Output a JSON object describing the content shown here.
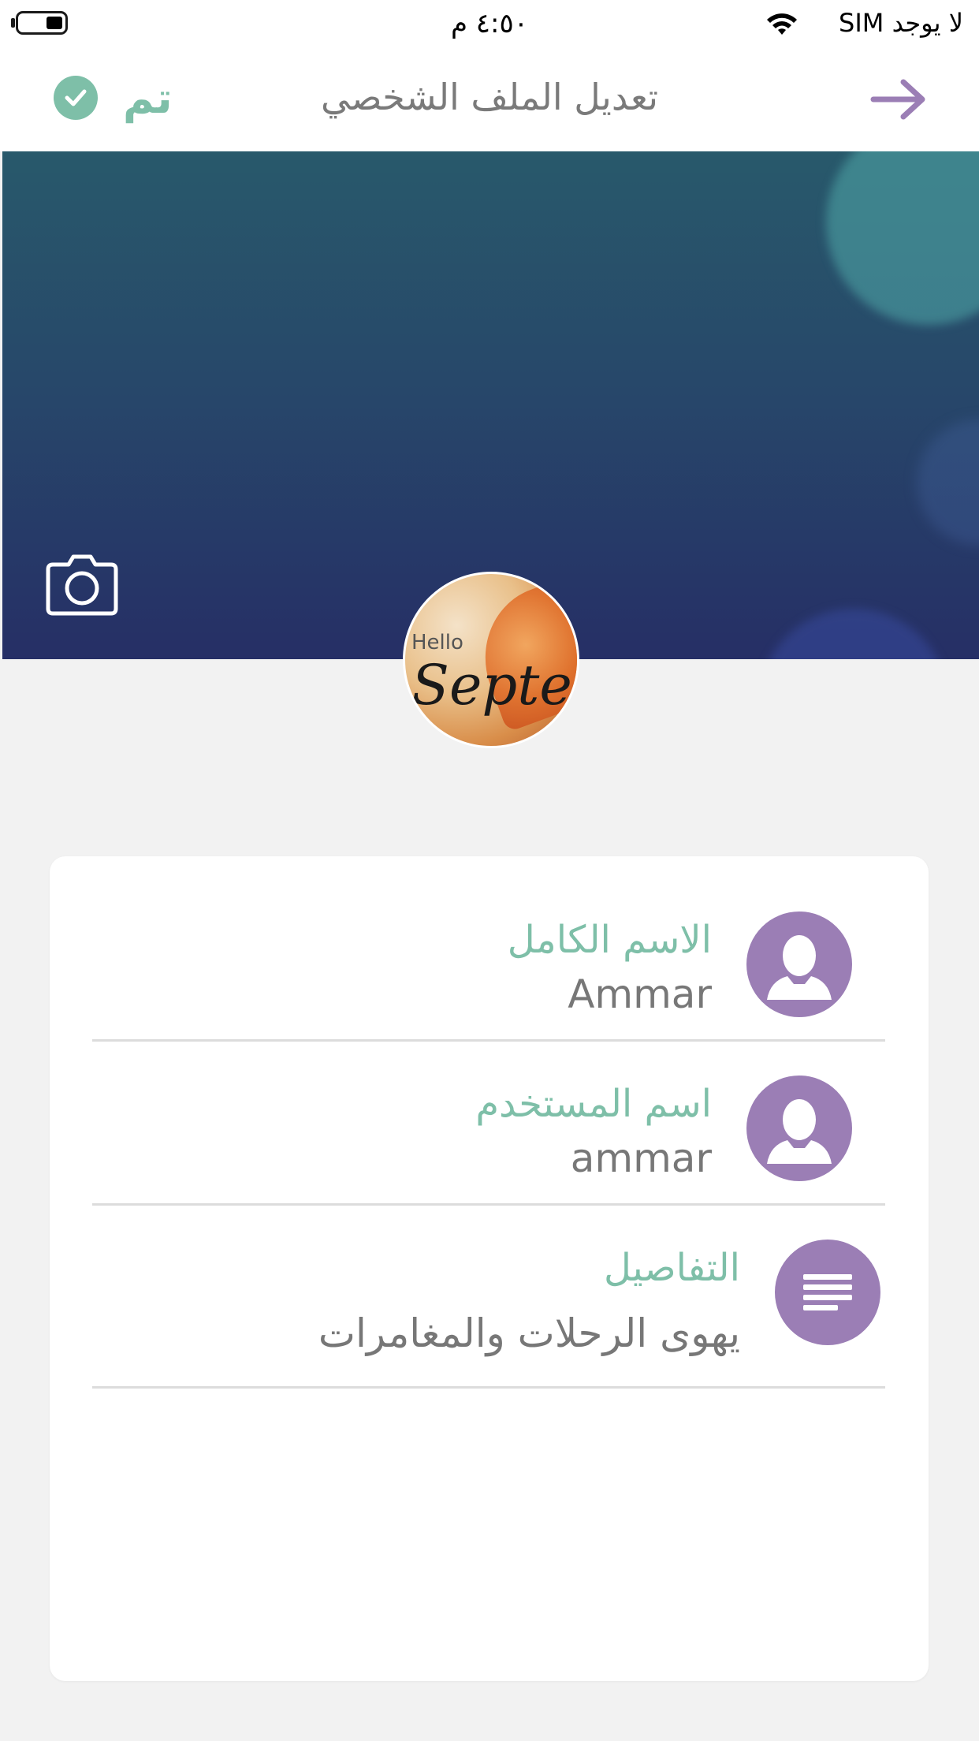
{
  "status_bar": {
    "carrier": "لا يوجد SIM",
    "time": "٤:٥٠ م",
    "wifi_icon": "wifi-icon",
    "battery_icon": "battery-icon"
  },
  "nav": {
    "title": "تعديل الملف الشخصي",
    "done_label": "تم",
    "done_icon": "check-circle-icon",
    "back_icon": "arrow-right-icon",
    "accent_color": "#7ebfa8",
    "back_color": "#9b7eb5"
  },
  "cover": {
    "camera_icon": "camera-icon"
  },
  "avatar": {
    "image_text_small": "Hello",
    "image_text": "Septem"
  },
  "fields": [
    {
      "label": "الاسم الكامل",
      "value": "Ammar",
      "icon": "person-icon"
    },
    {
      "label": "اسم المستخدم",
      "value": "ammar",
      "icon": "person-icon"
    },
    {
      "label": "التفاصيل",
      "value": "يهوى الرحلات والمغامرات",
      "icon": "text-lines-icon"
    }
  ],
  "colors": {
    "icon_bg": "#9b7eb5",
    "label": "#7ebfa8",
    "value": "#777777",
    "title": "#7a7a7a",
    "background": "#f2f2f2"
  }
}
